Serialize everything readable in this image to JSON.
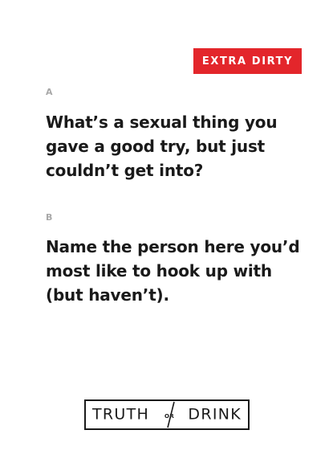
{
  "card": {
    "badge": "EXTRA DIRTY",
    "accent_color": "#e3262b",
    "questions": [
      {
        "label": "A",
        "text": "What’s a sexual thing you gave a good try, but just couldn’t get into?"
      },
      {
        "label": "B",
        "text": "Name the person here you’d most like to hook up with (but haven’t)."
      }
    ],
    "logo": {
      "left_word": "TRUTH",
      "connector": "OR",
      "right_word": "DRINK"
    }
  }
}
